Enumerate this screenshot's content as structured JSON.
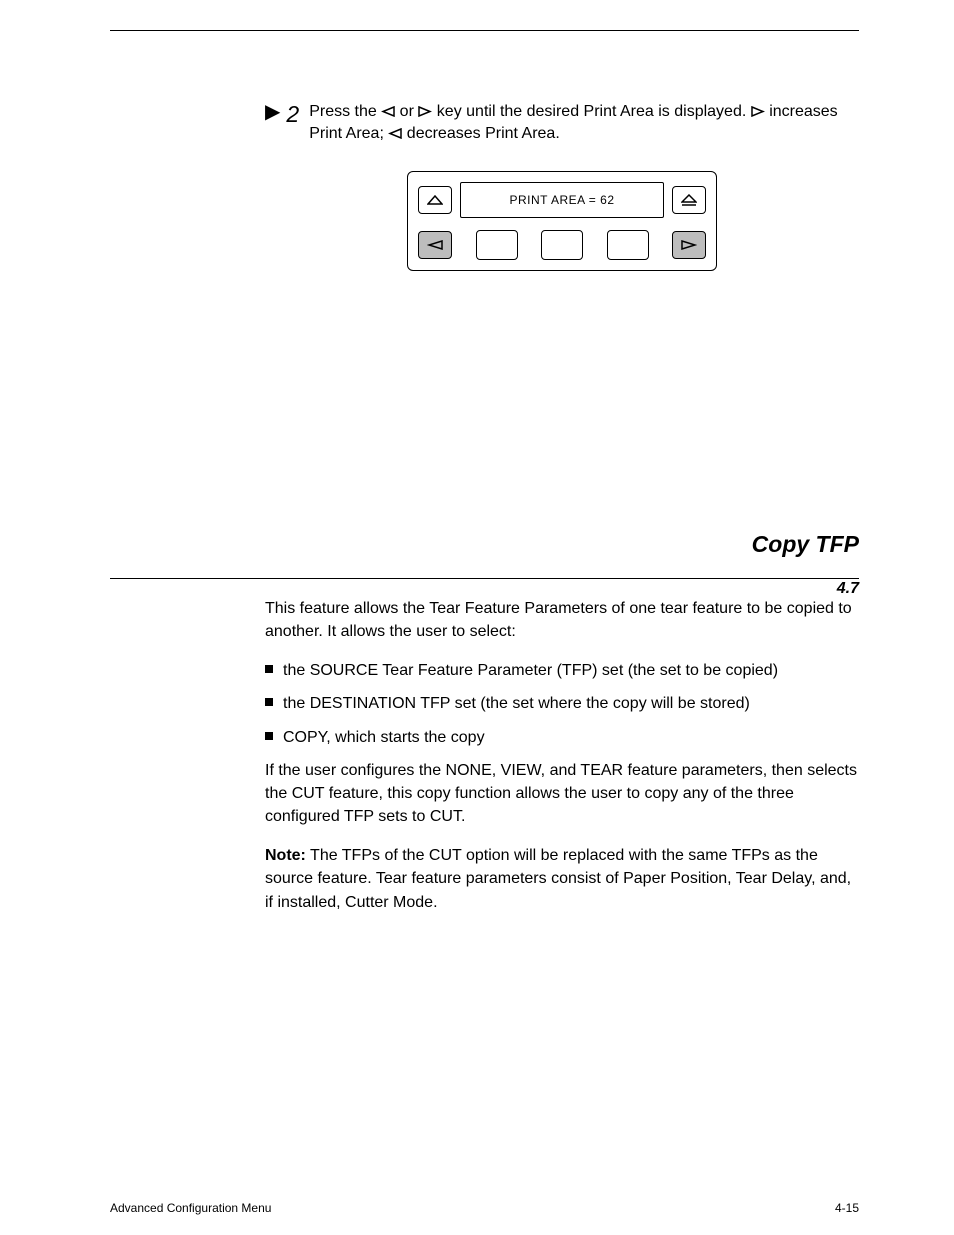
{
  "step": {
    "number": "2",
    "text_before_icons": "Press the ",
    "text_between_icons": " or ",
    "text_after_icons": " key until the desired Print Area is displayed. ",
    "text_increase": " increases Print Area; ",
    "text_decrease": " decreases Print Area."
  },
  "panel": {
    "display": "PRINT AREA = 62"
  },
  "section": {
    "title": "Copy TFP",
    "number": "4.7",
    "intro": "This feature allows the Tear Feature Parameters of one tear feature to be copied to another. It allows the user to select:",
    "bullets": [
      "the SOURCE Tear Feature Parameter (TFP) set (the set to be copied)",
      "the DESTINATION TFP set (the set where the copy will be stored)",
      "COPY, which starts the copy"
    ],
    "example": "If the user configures the NONE, VIEW, and TEAR feature parameters, then selects the CUT feature, this copy function allows the user to copy any of the three configured TFP sets to CUT.",
    "note_label": "Note:",
    "note_text": "The TFPs of the CUT option will be replaced with the same TFPs as the source feature. Tear feature parameters consist of Paper Position, Tear Delay, and, if installed, Cutter Mode."
  },
  "footer": {
    "left": "Advanced Configuration Menu",
    "right": "4-15"
  }
}
